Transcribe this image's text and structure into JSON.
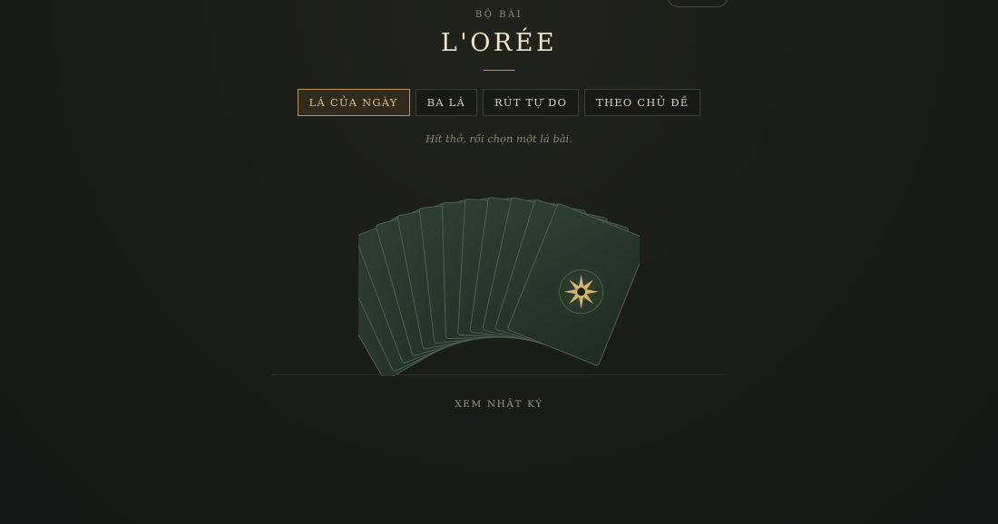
{
  "header": {
    "eyebrow": "BỘ BÀI",
    "title": "L'ORÉE"
  },
  "tabs": [
    {
      "label": "LÁ CỦA NGÀY",
      "active": true
    },
    {
      "label": "BA LÁ",
      "active": false
    },
    {
      "label": "RÚT TỰ DO",
      "active": false
    },
    {
      "label": "THEO CHỦ ĐỀ",
      "active": false
    }
  ],
  "hint": "Hít thở, rồi chọn một lá bài.",
  "deck": {
    "card_count": 12,
    "back_icon": "eight-point-star-icon"
  },
  "footer": {
    "journal_link": "XEM NHẬT KÝ"
  },
  "colors": {
    "accent": "#d4b36a",
    "card_fill": "#28392f",
    "card_border": "#4d6050",
    "background": "#161a17"
  }
}
